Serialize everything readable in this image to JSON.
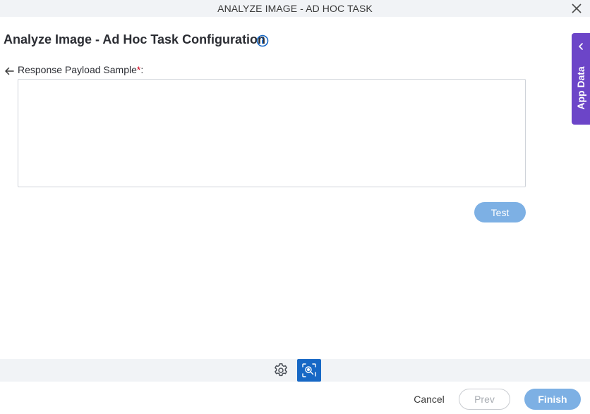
{
  "window": {
    "title": "ANALYZE IMAGE - AD HOC TASK",
    "close_icon": "close-icon"
  },
  "page": {
    "title": "Analyze Image - Ad Hoc Task Configuration",
    "info_icon": "info-circle-icon"
  },
  "form": {
    "back_icon": "arrow-left-icon",
    "payload_label": "Response Payload Sample",
    "required_mark": "*",
    "label_suffix": ":",
    "payload_value": "",
    "test_label": "Test"
  },
  "side_tab": {
    "label": "App Data",
    "icon": "chevron-left-icon"
  },
  "toolstrip": {
    "settings_icon": "gear-icon",
    "capture_icon": "image-search-icon"
  },
  "footer": {
    "cancel_label": "Cancel",
    "prev_label": "Prev",
    "finish_label": "Finish"
  },
  "colors": {
    "accent_purple": "#6c45c8",
    "primary_blue": "#1768c5",
    "button_blue_light": "#7db0e4",
    "required_red": "#d0021b"
  }
}
